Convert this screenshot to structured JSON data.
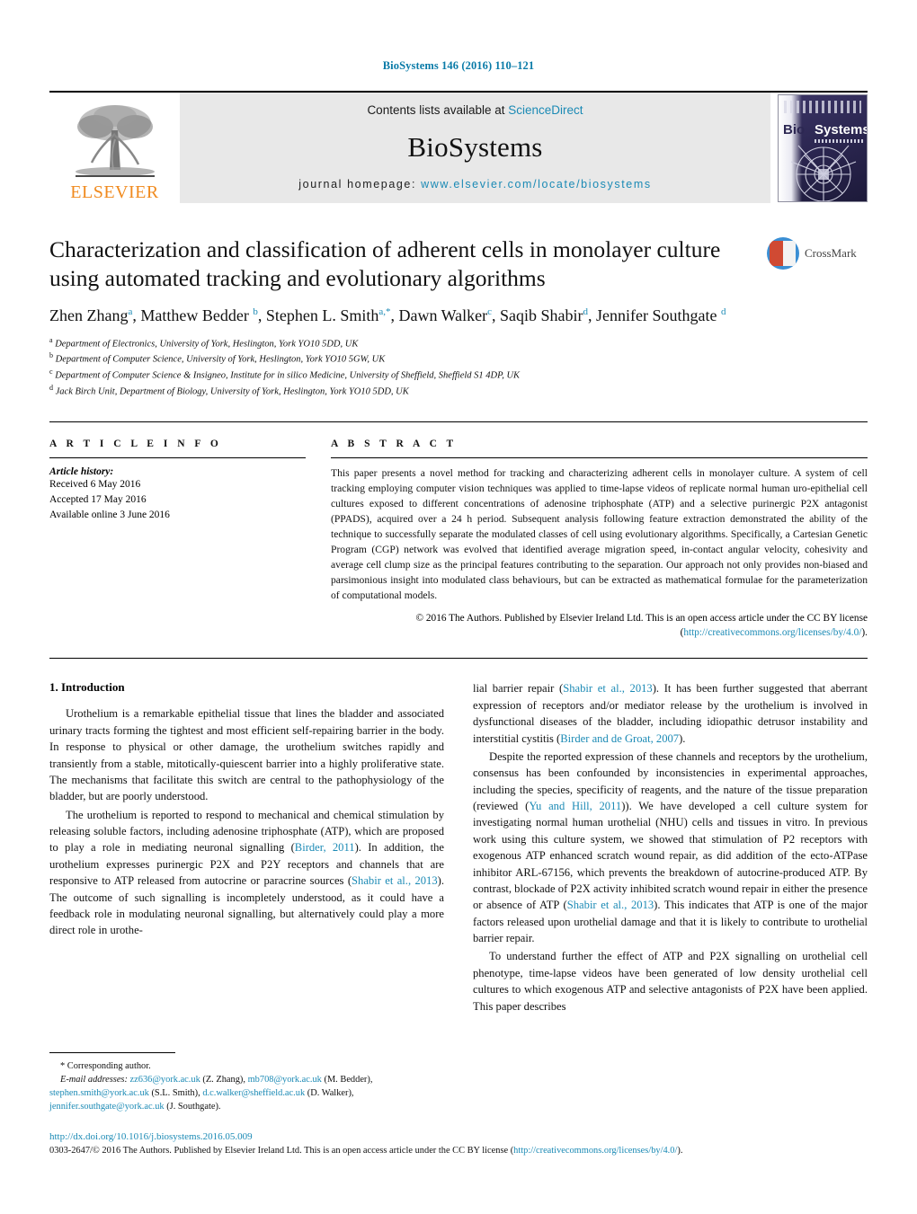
{
  "running_head": "BioSystems 146 (2016) 110–121",
  "masthead": {
    "publisher_logo_label": "ELSEVIER",
    "contents_prefix": "Contents lists available at ",
    "contents_link": "ScienceDirect",
    "journal_name": "BioSystems",
    "homepage_prefix": "journal homepage: ",
    "homepage_url": "www.elsevier.com/locate/biosystems",
    "cover": {
      "bio": "Bio",
      "systems": "Systems"
    }
  },
  "article": {
    "title": "Characterization and classification of adherent cells in monolayer culture using automated tracking and evolutionary algorithms",
    "authors_html": "Zhen Zhang<sup>a</sup>, Matthew Bedder <sup>b</sup>, Stephen L. Smith<sup>a,*</sup>, Dawn Walker<sup>c</sup>, Saqib Shabir<sup>d</sup>, Jennifer Southgate <sup>d</sup>",
    "affiliations": [
      {
        "mark": "a",
        "text": "Department of Electronics, University of York, Heslington, York YO10 5DD, UK"
      },
      {
        "mark": "b",
        "text": "Department of Computer Science, University of York, Heslington, York YO10 5GW, UK"
      },
      {
        "mark": "c",
        "text": "Department of Computer Science & Insigneo, Institute for in silico Medicine, University of Sheffield, Sheffield S1 4DP, UK"
      },
      {
        "mark": "d",
        "text": "Jack Birch Unit, Department of Biology, University of York, Heslington, York YO10 5DD, UK"
      }
    ],
    "crossmark_label": "CrossMark"
  },
  "article_info": {
    "heading": "A R T I C L E   I N F O",
    "history_title": "Article history:",
    "received": "Received 6 May 2016",
    "accepted": "Accepted 17 May 2016",
    "available": "Available online 3 June 2016"
  },
  "abstract": {
    "heading": "A B S T R A C T",
    "text": "This paper presents a novel method for tracking and characterizing adherent cells in monolayer culture. A system of cell tracking employing computer vision techniques was applied to time-lapse videos of replicate normal human uro-epithelial cell cultures exposed to different concentrations of adenosine triphosphate (ATP) and a selective purinergic P2X antagonist (PPADS), acquired over a 24 h period. Subsequent analysis following feature extraction demonstrated the ability of the technique to successfully separate the modulated classes of cell using evolutionary algorithms. Specifically, a Cartesian Genetic Program (CGP) network was evolved that identified average migration speed, in-contact angular velocity, cohesivity and average cell clump size as the principal features contributing to the separation. Our approach not only provides non-biased and parsimonious insight into modulated class behaviours, but can be extracted as mathematical formulae for the parameterization of computational models.",
    "copyright_prefix": "© 2016 The Authors. Published by Elsevier Ireland Ltd. This is an open access article under the CC BY license (",
    "copyright_link": "http://creativecommons.org/licenses/by/4.0/",
    "copyright_suffix": ")."
  },
  "body": {
    "section_title": "1.  Introduction",
    "left_paragraphs": [
      "Urothelium is a remarkable epithelial tissue that lines the bladder and associated urinary tracts forming the tightest and most efficient self-repairing barrier in the body. In response to physical or other damage, the urothelium switches rapidly and transiently from a stable, mitotically-quiescent barrier into a highly proliferative state. The mechanisms that facilitate this switch are central to the pathophysiology of the bladder, but are poorly understood."
    ],
    "left_para2_parts": {
      "p1": "The urothelium is reported to respond to mechanical and chemical stimulation by releasing soluble factors, including adenosine triphosphate (ATP), which are proposed to play a role in mediating neuronal signalling (",
      "cite1": "Birder, 2011",
      "p2": "). In addition, the urothelium expresses purinergic P2X and P2Y receptors and channels that are responsive to ATP released from autocrine or paracrine sources (",
      "cite2": "Shabir et al., 2013",
      "p3": "). The outcome of such signalling is incompletely understood, as it could have a feedback role in modulating neuronal signalling, but alternatively could play a more direct role in urothe-"
    },
    "right_para1_parts": {
      "p1": "lial barrier repair (",
      "cite1": "Shabir et al., 2013",
      "p2": "). It has been further suggested that aberrant expression of receptors and/or mediator release by the urothelium is involved in dysfunctional diseases of the bladder, including idiopathic detrusor instability and interstitial cystitis (",
      "cite2": "Birder and de Groat, 2007",
      "p3": ")."
    },
    "right_para2_parts": {
      "p1": "Despite the reported expression of these channels and receptors by the urothelium, consensus has been confounded by inconsistencies in experimental approaches, including the species, specificity of reagents, and the nature of the tissue preparation (reviewed (",
      "cite1": "Yu and Hill, 2011",
      "p2": ")). We have developed a cell culture system for investigating normal human urothelial (NHU) cells and tissues in vitro. In previous work using this culture system, we showed that stimulation of P2 receptors with exogenous ATP enhanced scratch wound repair, as did addition of the ecto-ATPase inhibitor ARL-67156, which prevents the breakdown of autocrine-produced ATP. By contrast, blockade of P2X activity inhibited scratch wound repair in either the presence or absence of ATP (",
      "cite2": "Shabir et al., 2013",
      "p3": "). This indicates that ATP is one of the major factors released upon urothelial damage and that it is likely to contribute to urothelial barrier repair."
    },
    "right_paragraphs_tail": [
      "To understand further the effect of ATP and P2X signalling on urothelial cell phenotype, time-lapse videos have been generated of low density urothelial cell cultures to which exogenous ATP and selective antagonists of P2X have been applied. This paper describes"
    ]
  },
  "footnote": {
    "corresponding": "* Corresponding author.",
    "emails_label": "E-mail addresses:",
    "entries": [
      {
        "email": "zz636@york.ac.uk",
        "name": " (Z. Zhang), "
      },
      {
        "email": "mb708@york.ac.uk",
        "name": " (M. Bedder), "
      },
      {
        "email": "stephen.smith@york.ac.uk",
        "name": " (S.L. Smith), "
      },
      {
        "email": "d.c.walker@sheffield.ac.uk",
        "name": " (D. Walker), "
      },
      {
        "email": "jennifer.southgate@york.ac.uk",
        "name": " (J. Southgate)."
      }
    ]
  },
  "bottom": {
    "doi": "http://dx.doi.org/10.1016/j.biosystems.2016.05.009",
    "cc_prefix": "0303-2647/© 2016 The Authors. Published by Elsevier Ireland Ltd. This is an open access article under the CC BY license (",
    "cc_link": "http://creativecommons.org/licenses/by/4.0/",
    "cc_suffix": ")."
  },
  "colors": {
    "link": "#1b8ab5",
    "elsevier_orange": "#f08a1e",
    "cover_navy": "#2c2752"
  }
}
